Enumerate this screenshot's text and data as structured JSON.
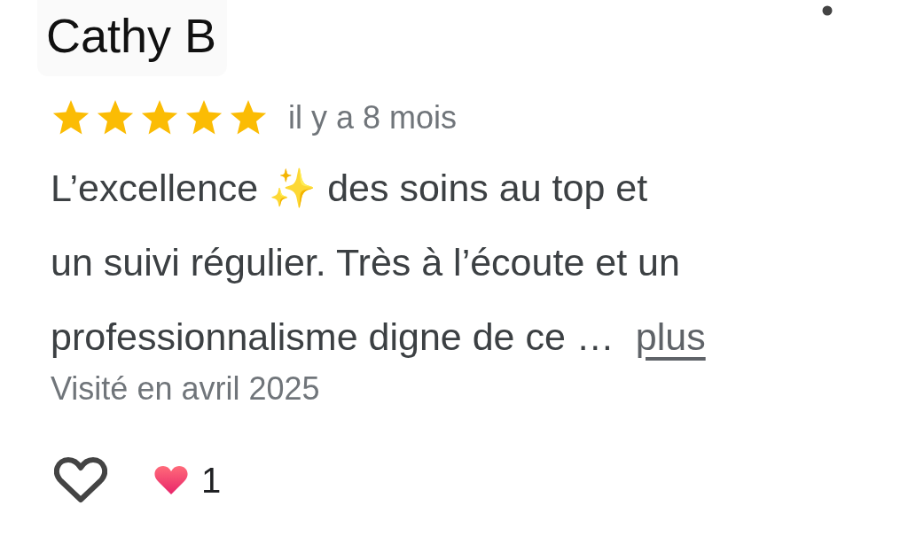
{
  "reviewer": {
    "name": "Cathy B"
  },
  "rating": {
    "stars": 5,
    "time": "il y a 8 mois"
  },
  "review": {
    "lines": [
      "L’excellence ✨ des soins au top et",
      "un suivi régulier. Très à l’écoute et un",
      "professionnalisme digne de ce …"
    ],
    "more_link": "plus"
  },
  "visit": "Visité en avril 2025",
  "reactions": {
    "liked": false,
    "count": "1"
  }
}
